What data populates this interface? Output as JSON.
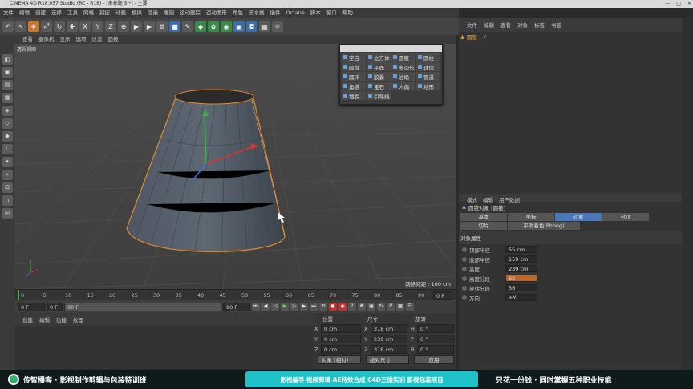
{
  "window": {
    "title": "CINEMA 4D R18.057 Studio (RC - R18) - [未标题 5 *] - 主要"
  },
  "menu": [
    "文件",
    "编辑",
    "创建",
    "选择",
    "工具",
    "网格",
    "捕捉",
    "动画",
    "模拟",
    "渲染",
    "雕刻",
    "运动跟踪",
    "运动图形",
    "角色",
    "流水线",
    "插件",
    "Octane",
    "脚本",
    "窗口",
    "帮助"
  ],
  "toolbar": {
    "axis_x": "X",
    "axis_y": "Y",
    "axis_z": "Z"
  },
  "viewport": {
    "menu": [
      "查看",
      "摄像机",
      "显示",
      "选项",
      "过滤",
      "面板"
    ],
    "label": "透视视图",
    "grid_info": "网格间距 : 100 cm"
  },
  "primitives_popup": {
    "items": [
      "空白",
      "立方体",
      "圆锥",
      "圆柱",
      "圆盘",
      "平面",
      "多边形",
      "球体",
      "圆环",
      "胶囊",
      "油桶",
      "管道",
      "角锥",
      "宝石",
      "人偶",
      "地形",
      "地貌",
      "引导线"
    ]
  },
  "timeline": {
    "ticks": [
      "0",
      "5",
      "10",
      "15",
      "20",
      "25",
      "30",
      "35",
      "40",
      "45",
      "50",
      "55",
      "60",
      "65",
      "70",
      "75",
      "80",
      "85",
      "90"
    ],
    "end_label": "0 F"
  },
  "playback": {
    "current_frame": "0 F",
    "start_field": "0 F",
    "end_field": "90 F",
    "max_field": "90 F"
  },
  "materials": {
    "menu": [
      "创建",
      "编辑",
      "功能",
      "纹理"
    ]
  },
  "coords": {
    "headers": [
      "位置",
      "尺寸",
      "旋转"
    ],
    "rows": [
      {
        "axis": "X",
        "pos": "0 cm",
        "size": "318 cm",
        "rot_axis": "H",
        "rot": "0 °"
      },
      {
        "axis": "Y",
        "pos": "0 cm",
        "size": "239 cm",
        "rot_axis": "P",
        "rot": "0 °"
      },
      {
        "axis": "Z",
        "pos": "0 cm",
        "size": "318 cm",
        "rot_axis": "B",
        "rot": "0 °"
      }
    ],
    "mode_select": "对象 (相对)",
    "size_select": "绝对尺寸",
    "apply": "应用"
  },
  "objects": {
    "menu": [
      "文件",
      "编辑",
      "查看",
      "对象",
      "标签",
      "书签"
    ],
    "items": [
      {
        "name": "圆锥"
      }
    ]
  },
  "attributes": {
    "menu": [
      "模式",
      "编辑",
      "用户数据"
    ],
    "object_title": "圆锥对象 [圆锥]",
    "tabs_row1": [
      "基本",
      "坐标",
      "对象",
      "封顶"
    ],
    "tabs_row2": [
      "切片",
      "平滑着色(Phong)"
    ],
    "active_tab": "对象",
    "section": "对象属性",
    "props": [
      {
        "label": "顶部半径",
        "value": "55 cm"
      },
      {
        "label": "底部半径",
        "value": "159 cm"
      },
      {
        "label": "高度",
        "value": "239 cm"
      },
      {
        "label": "高度分段",
        "value": "62",
        "selected": true
      },
      {
        "label": "旋转分段",
        "value": "36"
      },
      {
        "label": "方向",
        "value": "+Y"
      }
    ]
  },
  "banner": {
    "left": "传智播客 · 影视制作剪辑与包装特训班",
    "middle": "影视编导 视频剪辑 AE特效合成 C4D三维实训 影视包装项目",
    "right": "只花一份钱 · 同时掌握五种职业技能"
  }
}
